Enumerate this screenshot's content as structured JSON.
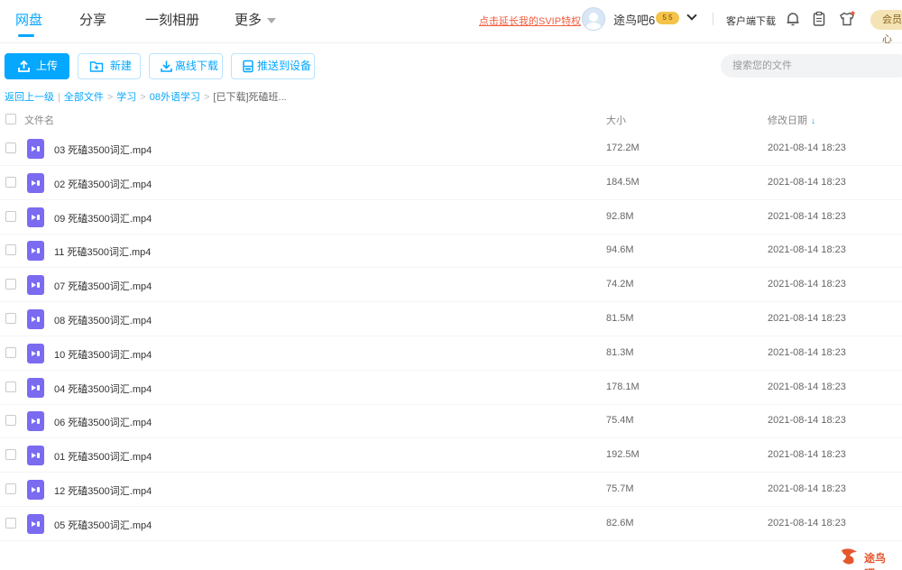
{
  "nav": {
    "tabs": [
      "网盘",
      "分享",
      "一刻相册",
      "更多"
    ],
    "promo": "点击延长我的SVIP特权",
    "username": "途鸟吧6",
    "vip_badge": "5 5",
    "client_download": "客户端下载",
    "member": "会员中心"
  },
  "toolbar": {
    "upload": "上传",
    "new_folder": "新建",
    "offline_download": "离线下载",
    "push_to_device": "推送到设备",
    "search_placeholder": "搜索您的文件"
  },
  "breadcrumb": {
    "back": "返回上一级",
    "items": [
      "全部文件",
      "学习",
      "08外语学习"
    ],
    "current": "[已下载]死磕班..."
  },
  "table": {
    "headers": {
      "name": "文件名",
      "size": "大小",
      "modified": "修改日期"
    },
    "sort_indicator": "↓",
    "rows": [
      {
        "name": "03 死磕3500词汇.mp4",
        "size": "172.2M",
        "date": "2021-08-14 18:23"
      },
      {
        "name": "02 死磕3500词汇.mp4",
        "size": "184.5M",
        "date": "2021-08-14 18:23"
      },
      {
        "name": "09 死磕3500词汇.mp4",
        "size": "92.8M",
        "date": "2021-08-14 18:23"
      },
      {
        "name": "11 死磕3500词汇.mp4",
        "size": "94.6M",
        "date": "2021-08-14 18:23"
      },
      {
        "name": "07 死磕3500词汇.mp4",
        "size": "74.2M",
        "date": "2021-08-14 18:23"
      },
      {
        "name": "08 死磕3500词汇.mp4",
        "size": "81.5M",
        "date": "2021-08-14 18:23"
      },
      {
        "name": "10 死磕3500词汇.mp4",
        "size": "81.3M",
        "date": "2021-08-14 18:23"
      },
      {
        "name": "04 死磕3500词汇.mp4",
        "size": "178.1M",
        "date": "2021-08-14 18:23"
      },
      {
        "name": "06 死磕3500词汇.mp4",
        "size": "75.4M",
        "date": "2021-08-14 18:23"
      },
      {
        "name": "01 死磕3500词汇.mp4",
        "size": "192.5M",
        "date": "2021-08-14 18:23"
      },
      {
        "name": "12 死磕3500词汇.mp4",
        "size": "75.7M",
        "date": "2021-08-14 18:23"
      },
      {
        "name": "05 死磕3500词汇.mp4",
        "size": "82.6M",
        "date": "2021-08-14 18:23"
      }
    ]
  },
  "watermark": {
    "text": "途鸟吧"
  },
  "colors": {
    "accent": "#06a7ff",
    "promo": "#f25d3f",
    "video_icon": "#7a6bf0"
  },
  "icons": [
    "upload-icon",
    "new-folder-icon",
    "download-icon",
    "device-icon",
    "bell-icon",
    "clipboard-icon",
    "shirt-icon",
    "video-file-icon",
    "sort-down-icon"
  ]
}
